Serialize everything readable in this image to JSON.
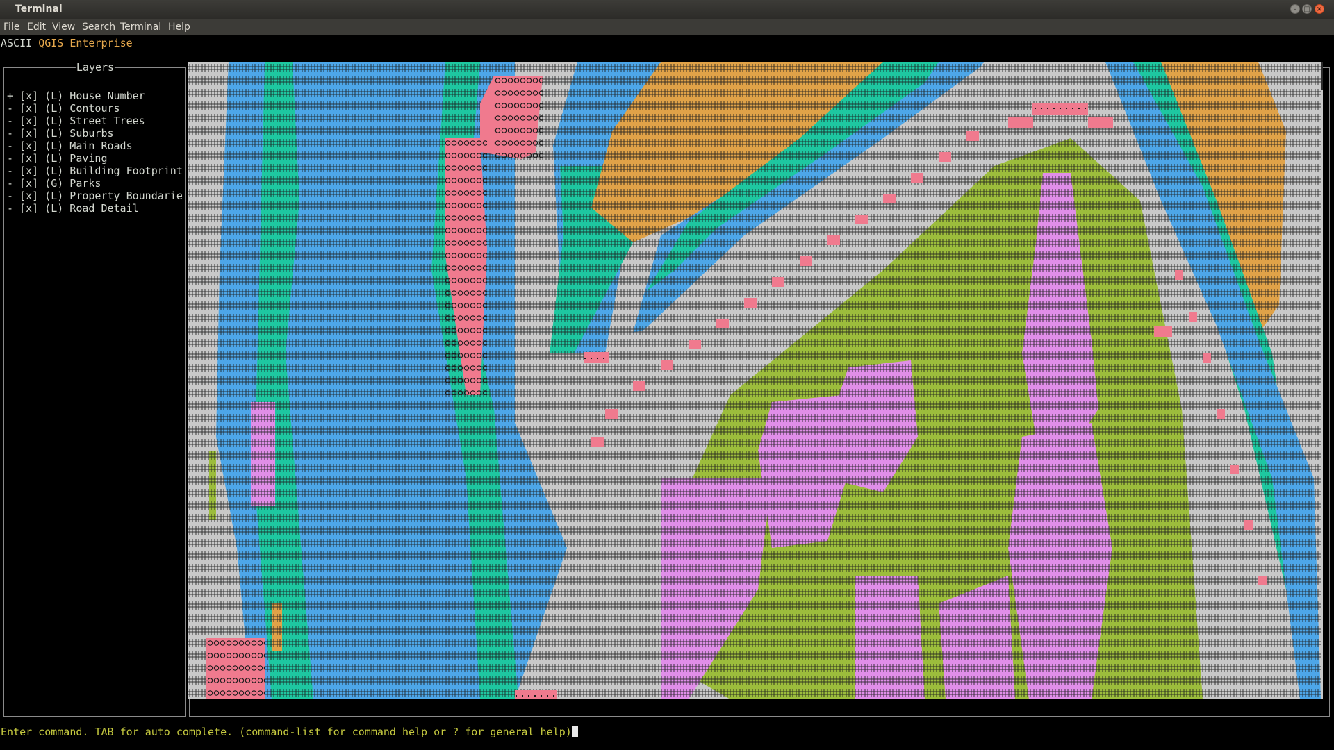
{
  "window": {
    "title": "Terminal",
    "minimize_glyph": "–",
    "maximize_glyph": "□",
    "close_glyph": "×"
  },
  "menu": {
    "file": "File",
    "edit": "Edit",
    "view": "View",
    "search": "Search",
    "terminal": "Terminal",
    "help": "Help"
  },
  "app": {
    "name_prefix": "ASCII",
    "name_main": "QGIS Enterprise"
  },
  "layers": {
    "title": "Layers",
    "items": [
      "+ [x] (L) House Number",
      "- [x] (L) Contours",
      "- [x] (L) Street Trees",
      "- [x] (L) Suburbs",
      "- [x] (L) Main Roads",
      "- [x] (L) Paving",
      "- [x] (L) Building Footprint",
      "- [x] (G) Parks",
      "- [x] (L) Property Boundarie",
      "- [x] (L) Road Detail"
    ]
  },
  "command": {
    "prompt": "Enter command. TAB for auto complete. (command-list for command help or ? for general help)"
  },
  "colors": {
    "terminal_bg": "#000000",
    "titlebar": "#3c3b37",
    "map_bg": "#c8c8c8",
    "water_blue": "#4da6e8",
    "teal": "#1ec7a0",
    "orange": "#e0a248",
    "olive_green": "#9cbd3c",
    "violet": "#e08ee8",
    "pink_road": "#f07a8e",
    "hash_dark": "#1c1c1c",
    "command_text": "#c5c93f",
    "accent_text": "#e6a84c"
  },
  "map_glyphs": {
    "fill": "#",
    "building": "@",
    "road": "."
  }
}
